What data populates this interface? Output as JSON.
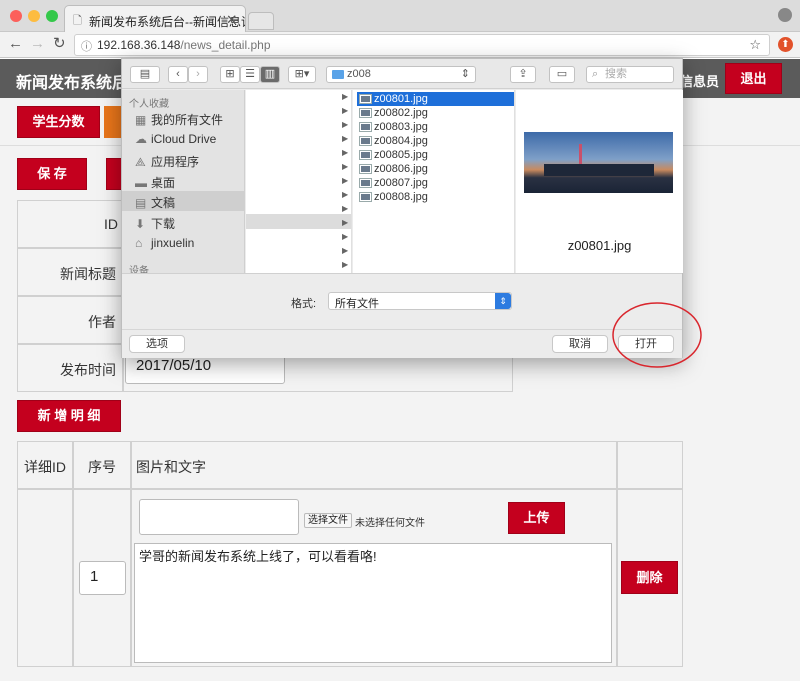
{
  "browser": {
    "tab_title": "新闻发布系统后台--新闻信息详",
    "url_host": "192.168.36.148",
    "url_path": "/news_detail.php"
  },
  "app": {
    "brand": "新闻发布系统后",
    "header_tail": "信息员",
    "logout_label": "退出",
    "nav_first": "学生分数"
  },
  "form": {
    "save_label": "保 存",
    "id_label": "ID",
    "title_label": "新闻标题",
    "author_label": "作者",
    "time_label": "发布时间",
    "time_value": "2017/05/10",
    "add_detail_label": "新 增 明 细"
  },
  "detail_table": {
    "headers": [
      "详细ID",
      "序号",
      "图片和文字"
    ],
    "row": {
      "seq_value": "1",
      "choose_file_label": "选择文件",
      "no_file_text": "未选择任何文件",
      "upload_label": "上传",
      "text_value": "学哥的新闻发布系统上线了，可以看看咯!",
      "delete_label": "删除"
    }
  },
  "dialog": {
    "folder": "z008",
    "search_placeholder": "搜索",
    "sidebar_favorites_title": "个人收藏",
    "sidebar_items": [
      {
        "label": "我的所有文件",
        "icon": "all-files-icon"
      },
      {
        "label": "iCloud Drive",
        "icon": "cloud-icon"
      },
      {
        "label": "应用程序",
        "icon": "applications-icon"
      },
      {
        "label": "桌面",
        "icon": "desktop-icon"
      },
      {
        "label": "文稿",
        "icon": "documents-icon"
      },
      {
        "label": "下载",
        "icon": "download-icon"
      },
      {
        "label": "jinxuelin",
        "icon": "home-icon"
      }
    ],
    "sidebar_devices_title": "设备",
    "files": [
      "z00801.jpg",
      "z00802.jpg",
      "z00803.jpg",
      "z00804.jpg",
      "z00805.jpg",
      "z00806.jpg",
      "z00807.jpg",
      "z00808.jpg"
    ],
    "preview_name": "z00801.jpg",
    "format_label": "格式:",
    "format_value": "所有文件",
    "options_label": "选项",
    "cancel_label": "取消",
    "open_label": "打开"
  },
  "colors": {
    "accent_red": "#c4001e",
    "selection_blue": "#1e6fd9",
    "header_gray": "#5b5b5b"
  }
}
